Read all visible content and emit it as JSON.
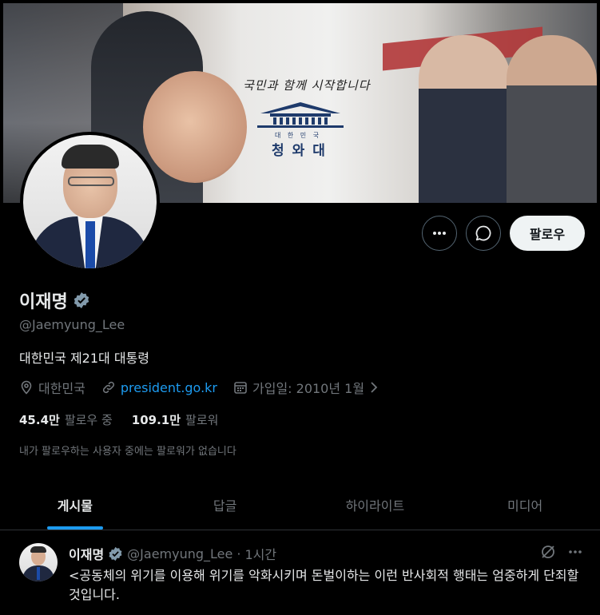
{
  "banner": {
    "slogan": "국민과 함께 시작합니다",
    "office_small": "대 한 민 국",
    "office_name": "청와대"
  },
  "profile": {
    "name": "이재명",
    "handle": "@Jaemyung_Lee",
    "bio": "대한민국 제21대 대통령",
    "location": "대한민국",
    "website": "president.go.kr",
    "joined": "가입일: 2010년 1월",
    "following_count": "45.4만",
    "following_label": "팔로우 중",
    "followers_count": "109.1만",
    "followers_label": "팔로워",
    "no_mutual_followers": "내가 팔로우하는 사용자 중에는 팔로워가 없습니다"
  },
  "actions": {
    "follow_label": "팔로우",
    "more_icon": "more-horizontal-icon",
    "message_icon": "message-icon"
  },
  "tabs": [
    {
      "label": "게시물",
      "active": true
    },
    {
      "label": "답글",
      "active": false
    },
    {
      "label": "하이라이트",
      "active": false
    },
    {
      "label": "미디어",
      "active": false
    }
  ],
  "post": {
    "author_name": "이재명",
    "author_handle": "@Jaemyung_Lee",
    "separator": "·",
    "time": "1시간",
    "text": "<공동체의 위기를 이용해 위기를 악화시키며 돈벌이하는 이런 반사회적 행태는 엄중하게 단죄할 것입니다."
  },
  "colors": {
    "background": "#000000",
    "accent": "#1d9bf0",
    "text_primary": "#e7e9ea",
    "text_secondary": "#71767b",
    "verified_badge": "#829aab"
  }
}
